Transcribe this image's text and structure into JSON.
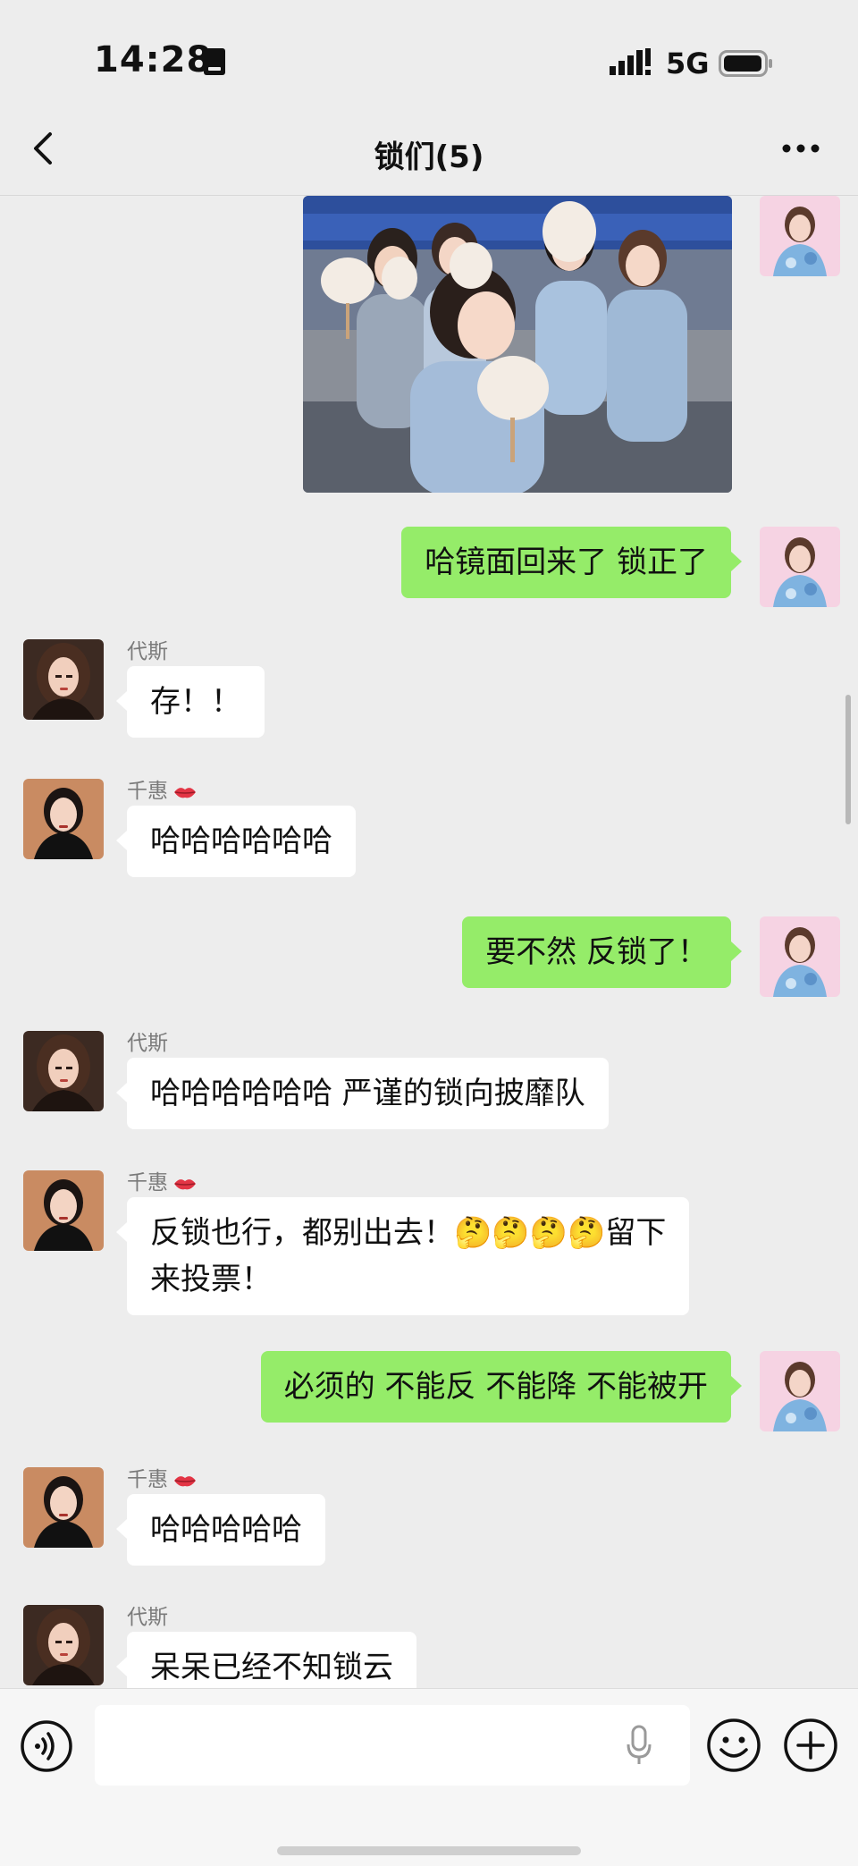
{
  "status": {
    "time": "14:28",
    "network": "5G"
  },
  "header": {
    "title": "锁们(5)"
  },
  "messages": [
    {
      "side": "right",
      "type": "image",
      "alt": ""
    },
    {
      "side": "right",
      "text": "哈镜面回来了 锁正了"
    },
    {
      "side": "left",
      "sender": "代斯",
      "text": "存！！"
    },
    {
      "side": "left",
      "sender": "千惠",
      "text": "哈哈哈哈哈哈"
    },
    {
      "side": "right",
      "text": "要不然 反锁了！"
    },
    {
      "side": "left",
      "sender": "代斯",
      "text": "哈哈哈哈哈哈 严谨的锁向披靡队"
    },
    {
      "side": "left",
      "sender": "千惠",
      "text_line1": "反锁也行，都别出去！🤔🤔🤔🤔留下",
      "text_line2": "来投票！"
    },
    {
      "side": "right",
      "text": "必须的 不能反 不能降 不能被开"
    },
    {
      "side": "left",
      "sender": "千惠",
      "text": "哈哈哈哈哈"
    },
    {
      "side": "left",
      "sender": "代斯",
      "text": "呆呆已经不知锁云"
    }
  ],
  "input": {
    "placeholder": ""
  },
  "icons": {
    "back": "chevron-left-icon",
    "more": "more-dots-icon",
    "voice": "voice-icon",
    "mic": "microphone-icon",
    "emoji": "emoji-icon",
    "plus": "plus-icon"
  },
  "colors": {
    "background": "#ededed",
    "outgoing_bubble": "#95ec69",
    "incoming_bubble": "#ffffff"
  }
}
